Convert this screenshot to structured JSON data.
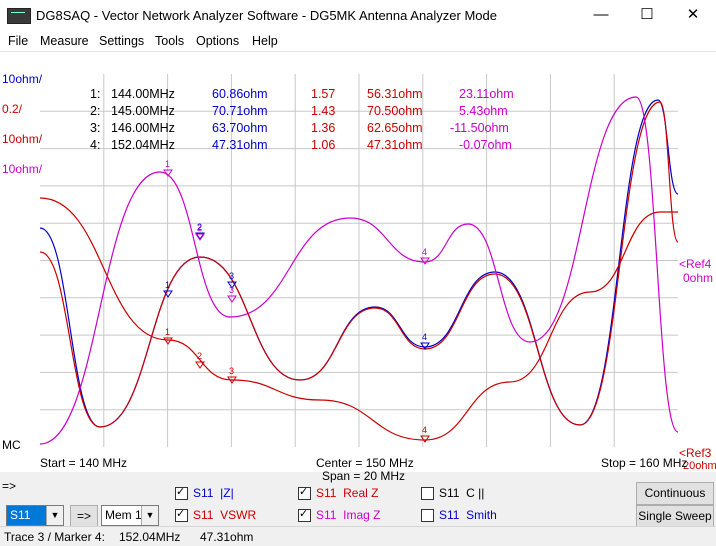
{
  "window": {
    "title": "DG8SAQ  -  Vector Network Analyzer Software - DG5MK Antenna Analyzer Mode",
    "minimize": "—",
    "maximize": "☐",
    "close": "✕"
  },
  "menu": [
    "File",
    "Measure",
    "Settings",
    "Tools",
    "Options",
    "Help"
  ],
  "scale_labels": {
    "left_1": "10ohm/",
    "left_2": "0.2/",
    "left_3": "10ohm/",
    "left_4": "10ohm/",
    "left_mc": "MC",
    "ref4": "<Ref4",
    "ref4_val": "0ohm",
    "ref3": "<Ref3",
    "ref3_val": "20ohm"
  },
  "markers": [
    {
      "num": "1:",
      "freq": "144.00MHz",
      "abs_z": "60.86ohm",
      "vswr": "1.57",
      "real_z": "56.31ohm",
      "imag_z": "23.11ohm"
    },
    {
      "num": "2:",
      "freq": "145.00MHz",
      "abs_z": "70.71ohm",
      "vswr": "1.43",
      "real_z": "70.50ohm",
      "imag_z": "5.43ohm"
    },
    {
      "num": "3:",
      "freq": "146.00MHz",
      "abs_z": "63.70ohm",
      "vswr": "1.36",
      "real_z": "62.65ohm",
      "imag_z": "-11.50ohm"
    },
    {
      "num": "4:",
      "freq": "152.04MHz",
      "abs_z": "47.31ohm",
      "vswr": "1.06",
      "real_z": "47.31ohm",
      "imag_z": "-0.07ohm"
    }
  ],
  "axis": {
    "start": "Start = 140 MHz",
    "center": "Center = 150 MHz",
    "span": "Span = 20 MHz",
    "stop": "Stop = 160 MHz"
  },
  "controls": {
    "arrow_label": "=>",
    "param_select": "S11",
    "mem_button": "=>",
    "mem_select": "Mem 1",
    "traces": [
      {
        "s": "S11",
        "name": "|Z|",
        "checked": true,
        "color": "#0000cc"
      },
      {
        "s": "S11",
        "name": "Real Z",
        "checked": true,
        "color": "#cc0000"
      },
      {
        "s": "S11",
        "name": "C ||",
        "checked": false,
        "color": "#000000"
      },
      {
        "s": "S11",
        "name": "VSWR",
        "checked": true,
        "color": "#cc0000"
      },
      {
        "s": "S11",
        "name": "Imag Z",
        "checked": true,
        "color": "#cc00cc"
      },
      {
        "s": "S11",
        "name": "Smith",
        "checked": false,
        "color": "#0000cc"
      }
    ],
    "continuous": "Continuous",
    "single_sweep": "Single Sweep"
  },
  "status": {
    "trace_marker": "Trace 3 / Marker 4:",
    "freq": "152.04MHz",
    "value": "47.31ohm"
  },
  "colors": {
    "absz": "#0000cc",
    "vswr": "#cc0000",
    "realz": "#cc0000",
    "imagz": "#cc00cc",
    "grid": "#c8c8c8"
  }
}
